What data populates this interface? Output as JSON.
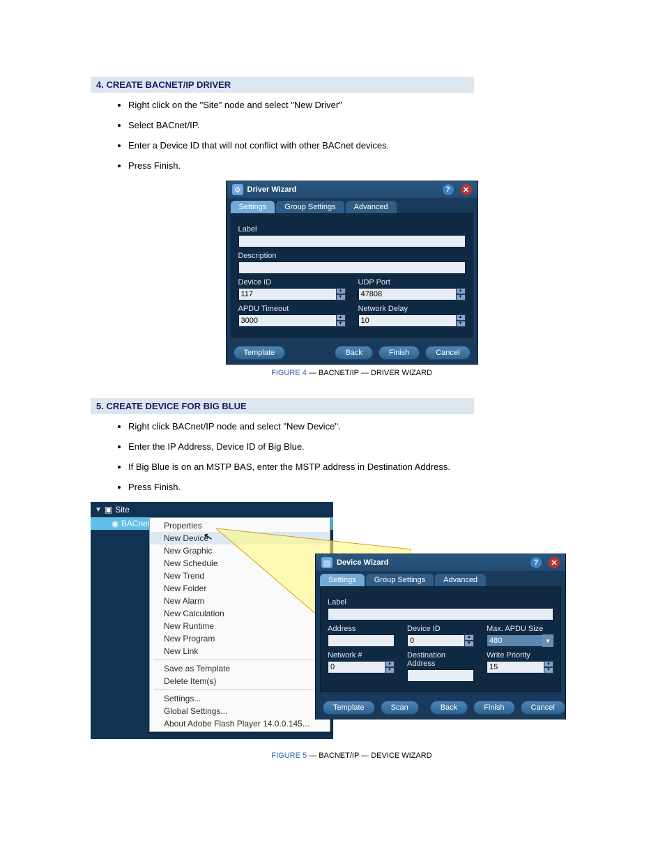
{
  "section1": {
    "title": "4. CREATE BACNET/IP DRIVER",
    "bullets": [
      "Right click on the \"Site\" node and select \"New Driver\"",
      "Select BACnet/IP.",
      "Enter a Device ID that will not conflict with other BACnet devices.",
      "Press Finish."
    ]
  },
  "driver_wizard": {
    "title": "Driver Wizard",
    "tabs": {
      "settings": "Settings",
      "group": "Group Settings",
      "advanced": "Advanced"
    },
    "labels": {
      "label": "Label",
      "description": "Description",
      "device_id": "Device ID",
      "udp_port": "UDP Port",
      "apdu_timeout": "APDU Timeout",
      "network_delay": "Network Delay"
    },
    "values": {
      "label": "",
      "description": "",
      "device_id": "117",
      "udp_port": "47808",
      "apdu_timeout": "3000",
      "network_delay": "10"
    },
    "buttons": {
      "template": "Template",
      "back": "Back",
      "finish": "Finish",
      "cancel": "Cancel"
    }
  },
  "fig1_caption": "FIGURE 4 — BACNET/IP — DRIVER WIZARD",
  "fig1_caption_num": "FIGURE 4",
  "fig1_caption_rest": " — BACNET/IP — DRIVER WIZARD",
  "section2": {
    "title": "5. CREATE DEVICE FOR BIG BLUE",
    "bullets": [
      "Right click BACnet/IP node and select \"New Device\".",
      "Enter the IP Address, Device ID of Big Blue.",
      "If Big Blue is on an MSTP BAS, enter the MSTP address in Destination Address.",
      "Press Finish."
    ]
  },
  "tree": {
    "site": "Site",
    "bacnet": "BACnet/IP"
  },
  "context_menu": {
    "items": [
      "Properties",
      "New Device",
      "New Graphic",
      "New Schedule",
      "New Trend",
      "New Folder",
      "New Alarm",
      "New Calculation",
      "New Runtime",
      "New Program",
      "New Link"
    ],
    "sep1": true,
    "items2": [
      "Save as Template",
      "Delete Item(s)"
    ],
    "sep2": true,
    "items3": [
      "Settings...",
      "Global Settings...",
      "About Adobe Flash Player 14.0.0.145..."
    ]
  },
  "device_wizard": {
    "title": "Device Wizard",
    "tabs": {
      "settings": "Settings",
      "group": "Group Settings",
      "advanced": "Advanced"
    },
    "labels": {
      "label": "Label",
      "address": "Address",
      "device_id": "Device ID",
      "max_apdu": "Max. APDU Size",
      "network_no": "Network #",
      "dest_addr": "Destination Address",
      "write_priority": "Write Priority"
    },
    "values": {
      "label": "",
      "address": "",
      "device_id": "0",
      "max_apdu": "480",
      "network_no": "0",
      "dest_addr": "",
      "write_priority": "15"
    },
    "buttons": {
      "template": "Template",
      "scan": "Scan",
      "back": "Back",
      "finish": "Finish",
      "cancel": "Cancel"
    }
  },
  "fig2_caption_num": "FIGURE 5",
  "fig2_caption_rest": " — BACNET/IP — DEVICE WIZARD"
}
